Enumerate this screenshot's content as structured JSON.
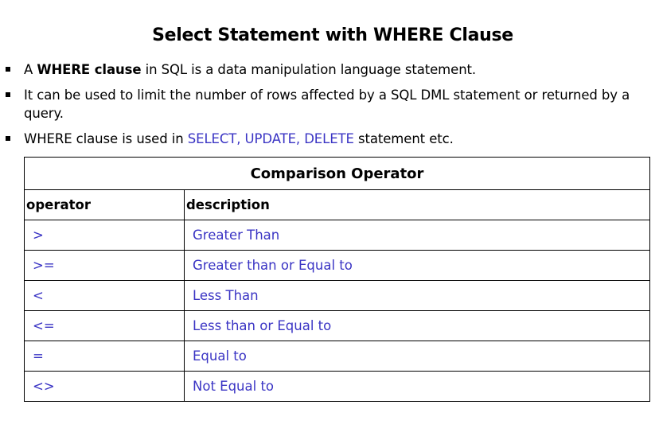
{
  "title": "Select Statement with WHERE Clause",
  "bullets": [
    {
      "prefix": "A ",
      "bold": "WHERE clause",
      "suffix": " in SQL is a data manipulation language statement."
    },
    {
      "text": "It can be used to limit the number of rows affected by a SQL DML statement or returned by a query."
    },
    {
      "prefix": "WHERE clause is used in ",
      "highlight": "SELECT, UPDATE, DELETE",
      "suffix": " statement etc."
    }
  ],
  "table": {
    "caption": "Comparison Operator",
    "headers": [
      "operator",
      "description"
    ],
    "rows": [
      {
        "operator": ">",
        "description": "Greater Than"
      },
      {
        "operator": ">=",
        "description": "Greater than or Equal to"
      },
      {
        "operator": "<",
        "description": "Less Than"
      },
      {
        "operator": "<=",
        "description": "Less than or Equal to"
      },
      {
        "operator": "=",
        "description": "Equal to"
      },
      {
        "operator": "<>",
        "description": "Not Equal to"
      }
    ]
  },
  "colors": {
    "highlight": "#3a34c4",
    "text": "#000000"
  }
}
